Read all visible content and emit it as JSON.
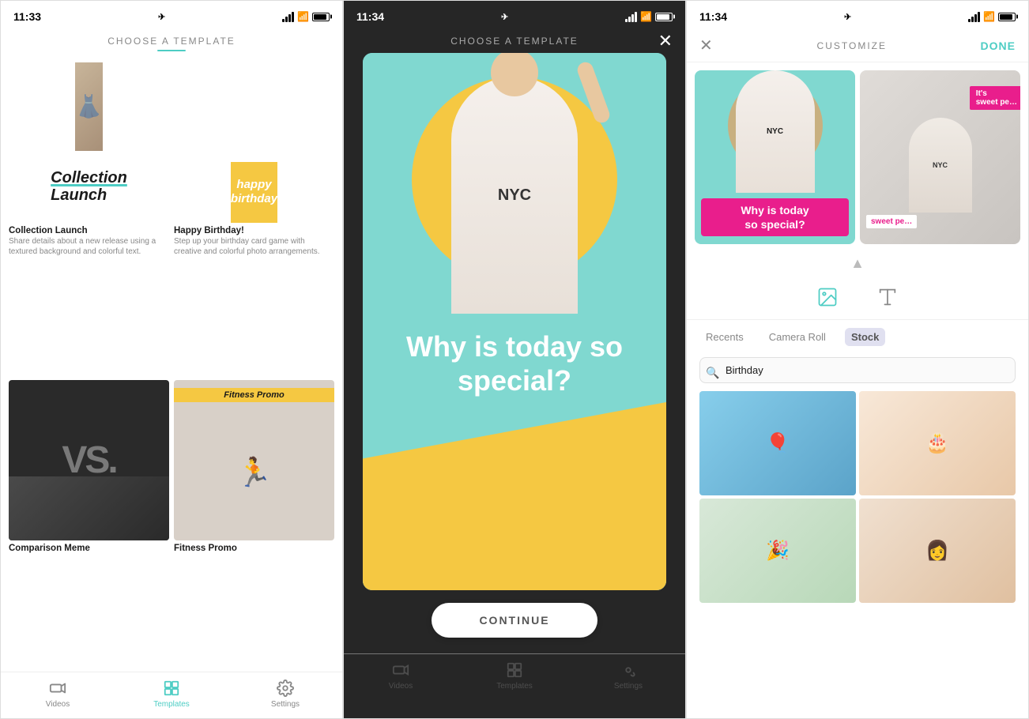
{
  "phone1": {
    "status": {
      "time": "11:33",
      "location": true
    },
    "header": {
      "title": "CHOOSE A TEMPLATE"
    },
    "templates": [
      {
        "name": "Collection Launch",
        "desc": "Share details about a new release using a textured background and colorful text.",
        "type": "collection"
      },
      {
        "name": "Happy Birthday!",
        "desc": "Step up your birthday card game with creative and colorful photo arrangements.",
        "type": "birthday"
      },
      {
        "name": "Comparison Meme",
        "desc": "",
        "type": "vs"
      },
      {
        "name": "Fitness Promo",
        "desc": "",
        "type": "fitness"
      }
    ],
    "nav": {
      "items": [
        {
          "label": "Videos",
          "icon": "video",
          "active": false
        },
        {
          "label": "Templates",
          "icon": "templates",
          "active": true
        },
        {
          "label": "Settings",
          "icon": "settings",
          "active": false
        }
      ]
    }
  },
  "phone2": {
    "status": {
      "time": "11:34"
    },
    "header": {
      "title": "CHOOSE A TEMPLATE"
    },
    "modal": {
      "question": "Why is today so special?",
      "continue_label": "CONTINUE"
    }
  },
  "phone3": {
    "status": {
      "time": "11:34"
    },
    "header": {
      "title": "CUSTOMIZE",
      "done_label": "DONE"
    },
    "tools": [
      "image-tool",
      "text-tool"
    ],
    "media_tabs": [
      "Recents",
      "Camera Roll",
      "Stock"
    ],
    "active_tab": "Stock",
    "search": {
      "placeholder": "Birthday",
      "value": "Birthday"
    },
    "photos": [
      {
        "label": "kid with balloons"
      },
      {
        "label": "birthday candles"
      },
      {
        "label": "party decorations"
      },
      {
        "label": "woman at party"
      }
    ],
    "preview_text": "Why is today so special?"
  }
}
